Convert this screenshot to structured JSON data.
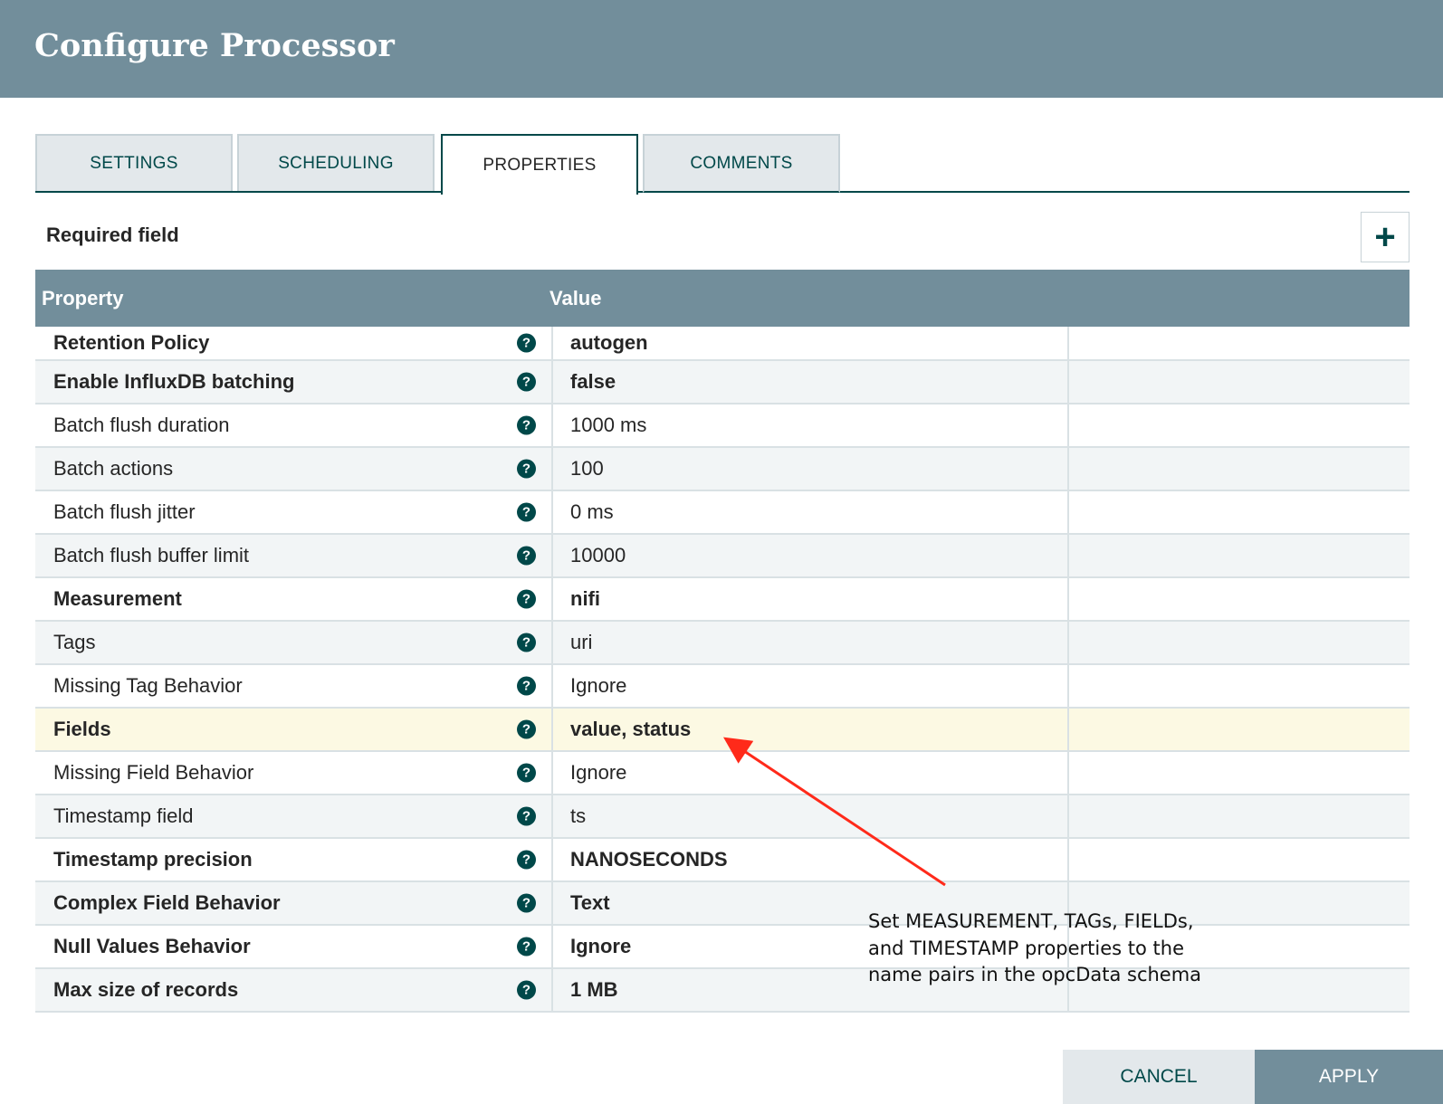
{
  "dialog": {
    "title": "Configure Processor"
  },
  "tabs": [
    {
      "label": "SETTINGS"
    },
    {
      "label": "SCHEDULING"
    },
    {
      "label": "PROPERTIES"
    },
    {
      "label": "COMMENTS"
    }
  ],
  "required_label": "Required field",
  "add_button": "+",
  "table": {
    "headers": {
      "property": "Property",
      "value": "Value"
    },
    "rows": [
      {
        "name": "Retention Policy",
        "value": "autogen",
        "required": true
      },
      {
        "name": "Enable InfluxDB batching",
        "value": "false",
        "required": true
      },
      {
        "name": "Batch flush duration",
        "value": "1000 ms",
        "required": false
      },
      {
        "name": "Batch actions",
        "value": "100",
        "required": false
      },
      {
        "name": "Batch flush jitter",
        "value": "0 ms",
        "required": false
      },
      {
        "name": "Batch flush buffer limit",
        "value": "10000",
        "required": false
      },
      {
        "name": "Measurement",
        "value": "nifi",
        "required": true
      },
      {
        "name": "Tags",
        "value": "uri",
        "required": false
      },
      {
        "name": "Missing Tag Behavior",
        "value": "Ignore",
        "required": false
      },
      {
        "name": "Fields",
        "value": "value, status",
        "required": true,
        "highlighted": true
      },
      {
        "name": "Missing Field Behavior",
        "value": "Ignore",
        "required": false
      },
      {
        "name": "Timestamp field",
        "value": "ts",
        "required": false
      },
      {
        "name": "Timestamp precision",
        "value": "NANOSECONDS",
        "required": true
      },
      {
        "name": "Complex Field Behavior",
        "value": "Text",
        "required": true
      },
      {
        "name": "Null Values Behavior",
        "value": "Ignore",
        "required": true
      },
      {
        "name": "Max size of records",
        "value": "1 MB",
        "required": true
      }
    ]
  },
  "annotation": {
    "lines": [
      "Set MEASUREMENT, TAGs, FIELDs,",
      "and TIMESTAMP properties to the",
      "name pairs in the opcData schema"
    ],
    "color": "#ff2a1a"
  },
  "buttons": {
    "cancel": "CANCEL",
    "apply": "APPLY"
  },
  "help_glyph": "?"
}
